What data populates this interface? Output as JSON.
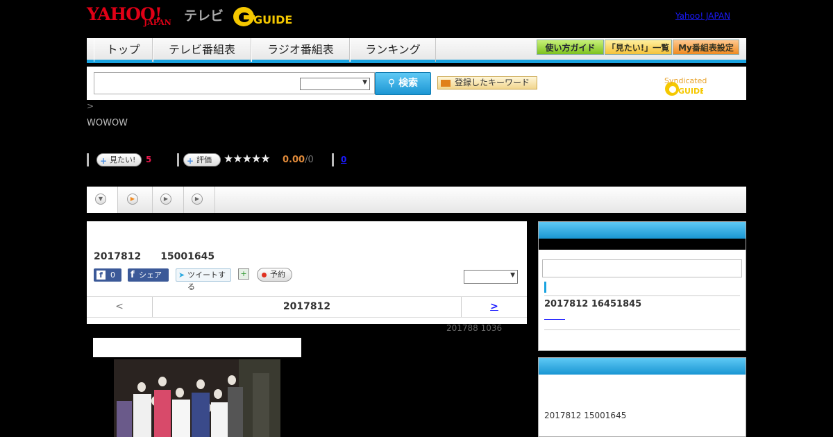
{
  "header": {
    "logo_yahoo": "YAHOO!",
    "logo_japan": "JAPAN",
    "logo_tv": "テレビ",
    "logo_guide": "GUIDE",
    "yahoo_link": "Yahoo! JAPAN"
  },
  "nav": {
    "tabs": [
      "トップ",
      "テレビ番組表",
      "ラジオ番組表",
      "ランキング"
    ],
    "buttons": [
      "使い方ガイド",
      "「見たい!」一覧",
      "My番組表設定"
    ]
  },
  "search": {
    "button": "検索",
    "keyword_button": "登録したキーワード",
    "syndicated": "Syndicated"
  },
  "breadcrumb": ">",
  "channel": "WOWOW",
  "stats": {
    "want_label": "見たい!",
    "want_count": "5",
    "rate_label": "評価",
    "stars": "★★★★★",
    "rating": "0.00",
    "rating_count": "/0",
    "comments": "0"
  },
  "program": {
    "date_time": "2017812　　15001645",
    "fb_count": "0",
    "fb_share": "シェア",
    "tweet": "ツイートする",
    "reserve": "予約",
    "nav_prev": "<",
    "nav_date": "2017812",
    "nav_next": ">",
    "updated": "201788  1036"
  },
  "sidebar": {
    "date_time": "2017812  16451845",
    "bottom_date_time": "2017812  15001645"
  },
  "colors": {
    "accent_blue": "#1aa3e0",
    "yahoo_red": "#e00016",
    "guide_yellow": "#f5c800"
  }
}
